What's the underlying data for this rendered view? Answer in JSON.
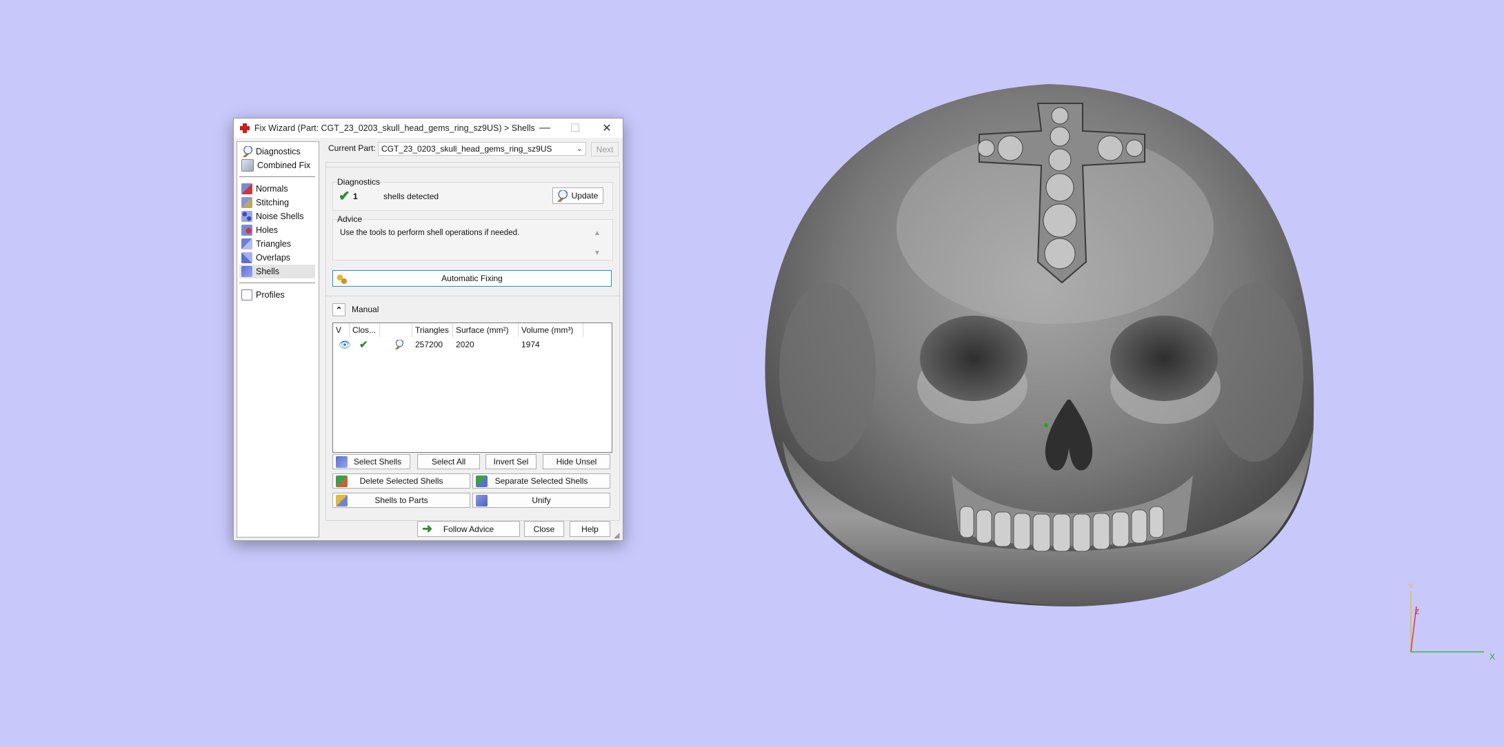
{
  "window": {
    "title": "Fix Wizard (Part: CGT_23_0203_skull_head_gems_ring_sz9US) > Shells",
    "minimize_glyph": "—",
    "maximize_glyph": "☐",
    "close_glyph": "✕"
  },
  "nav": {
    "items": [
      {
        "label": "Diagnostics",
        "icon": "magnifier-icon"
      },
      {
        "label": "Combined Fix",
        "icon": "box-icon"
      },
      {
        "label": "Normals",
        "icon": "normals-cube-icon"
      },
      {
        "label": "Stitching",
        "icon": "stitching-icon"
      },
      {
        "label": "Noise Shells",
        "icon": "noise-shells-icon"
      },
      {
        "label": "Holes",
        "icon": "holes-icon"
      },
      {
        "label": "Triangles",
        "icon": "triangles-icon"
      },
      {
        "label": "Overlaps",
        "icon": "overlaps-icon"
      },
      {
        "label": "Shells",
        "icon": "shells-icon",
        "selected": true
      },
      {
        "label": "Profiles",
        "icon": "document-icon"
      }
    ]
  },
  "current_part": {
    "label": "Current Part:",
    "value": "CGT_23_0203_skull_head_gems_ring_sz9US",
    "next_label": "Next"
  },
  "diagnostics": {
    "title": "Diagnostics",
    "count": "1",
    "text": "shells detected",
    "update_label": "Update"
  },
  "advice": {
    "title": "Advice",
    "text": "Use the tools to perform shell operations if needed."
  },
  "automatic_fixing_label": "Automatic Fixing",
  "manual": {
    "title": "Manual",
    "collapse_glyph": "⌃"
  },
  "table": {
    "columns": [
      "V",
      "Clos...",
      "",
      "Triangles",
      "Surface (mm²)",
      "Volume (mm³)"
    ],
    "rows": [
      {
        "triangles": "257200",
        "surface": "2020",
        "volume": "1974"
      }
    ]
  },
  "buttons": {
    "select_shells": "Select Shells",
    "select_all": "Select All",
    "invert_sel": "Invert Sel",
    "hide_unsel": "Hide Unsel",
    "delete_selected": "Delete Selected Shells",
    "separate_selected": "Separate Selected Shells",
    "shells_to_parts": "Shells to Parts",
    "unify": "Unify",
    "follow_advice": "Follow Advice",
    "close": "Close",
    "help": "Help"
  },
  "axes": {
    "x": "X",
    "y": "Y",
    "z": "Z"
  },
  "colors": {
    "background": "#c8c8fb",
    "accent_green": "#2e8b2e",
    "brand_red": "#d01c1c"
  }
}
